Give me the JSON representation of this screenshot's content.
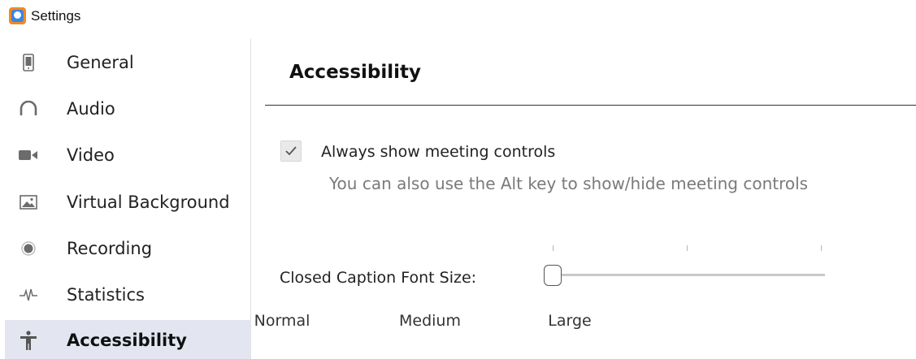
{
  "window": {
    "title": "Settings",
    "app_icon": "zoom-app-icon"
  },
  "sidebar": {
    "items": [
      {
        "label": "General",
        "icon": "phone-device-icon"
      },
      {
        "label": "Audio",
        "icon": "headphones-icon"
      },
      {
        "label": "Video",
        "icon": "video-camera-icon"
      },
      {
        "label": "Virtual Background",
        "icon": "image-icon"
      },
      {
        "label": "Recording",
        "icon": "record-dot-icon"
      },
      {
        "label": "Statistics",
        "icon": "pulse-icon"
      },
      {
        "label": "Accessibility",
        "icon": "person-accessibility-icon",
        "active": true
      }
    ],
    "active_bg": "#e3e6f0"
  },
  "main": {
    "title": "Accessibility",
    "meeting_controls": {
      "label": "Always show meeting controls",
      "checked": true,
      "hint": "You can also use the Alt key to show/hide meeting controls"
    },
    "caption_font": {
      "label": "Closed Caption Font Size:",
      "options": [
        "Normal",
        "Medium",
        "Large"
      ],
      "selected": "Normal",
      "selected_index": 0
    }
  }
}
